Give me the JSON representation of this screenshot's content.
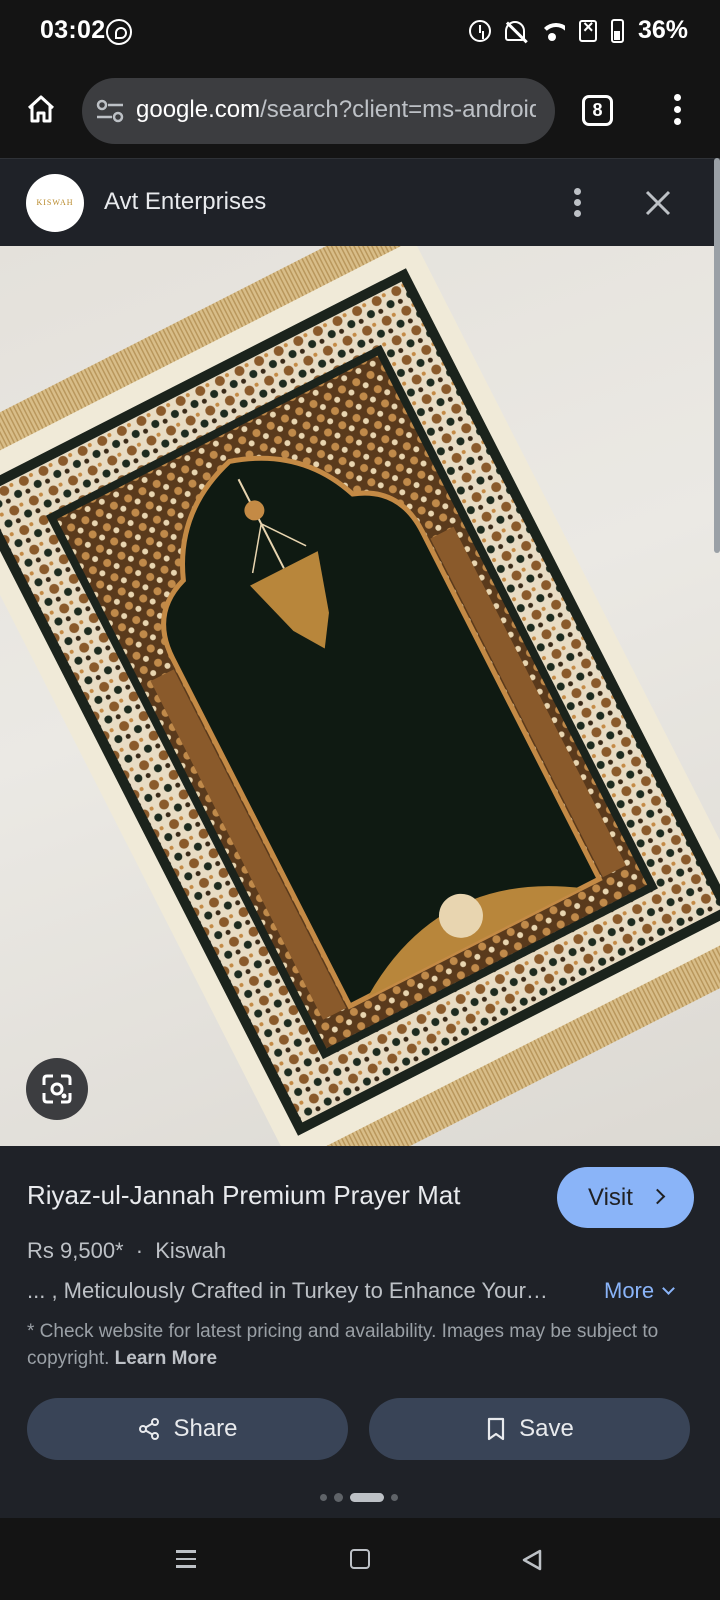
{
  "status_bar": {
    "time": "03:02",
    "battery": "36%"
  },
  "browser": {
    "url_host": "google.com",
    "url_path": "/search?client=ms-android-",
    "tab_count": "8"
  },
  "sheet": {
    "site_name": "Avt Enterprises",
    "logo_text": "KISWAH"
  },
  "product": {
    "title": "Riyaz-ul-Jannah Premium Prayer Mat",
    "visit_label": "Visit",
    "price": "Rs 9,500*",
    "separator": "·",
    "seller": "Kiswah",
    "description": "... , Meticulously Crafted in Turkey to Enhance Your…",
    "more_label": "More",
    "disclaimer": "* Check website for latest pricing and availability. Images may be subject to copyright.",
    "learn_more": "Learn More",
    "share_label": "Share",
    "save_label": "Save"
  },
  "carousel": {
    "count": 4,
    "active_index": 2
  },
  "colors": {
    "accent": "#8ab4f8",
    "sheet_bg": "#1f2228",
    "button_bg": "#394457",
    "rug_field": "#101a14",
    "rug_gold": "#b8863b",
    "fringe": "#cfb07a"
  }
}
